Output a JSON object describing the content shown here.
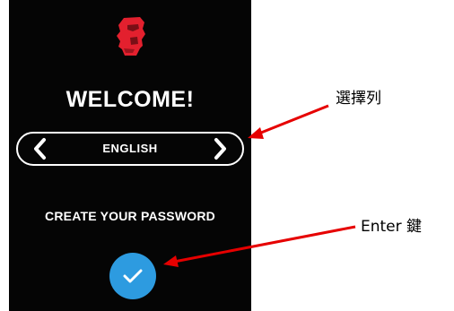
{
  "device": {
    "logo_icon": "kingston-head-logo",
    "title": "WELCOME!",
    "language_selector": {
      "prev_icon": "chevron-left-icon",
      "value": "ENGLISH",
      "next_icon": "chevron-right-icon"
    },
    "instruction": "CREATE YOUR PASSWORD",
    "enter_button": {
      "icon": "checkmark-icon",
      "color": "#2d9be0"
    },
    "background_color": "#050505",
    "logo_color": "#e3202e"
  },
  "annotations": {
    "selector_label": "選擇列",
    "enter_label": "Enter 鍵",
    "arrow_color": "#e60000"
  }
}
